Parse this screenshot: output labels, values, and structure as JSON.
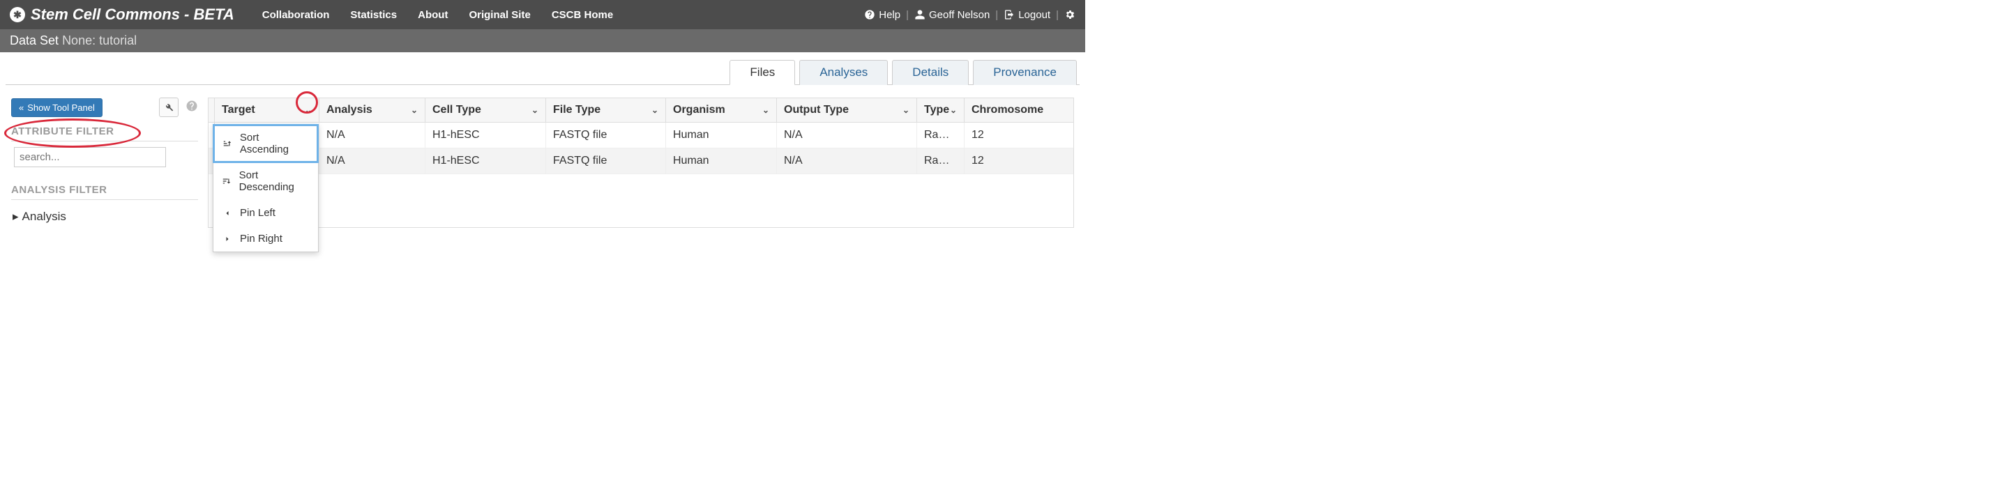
{
  "brand": "Stem Cell Commons - BETA",
  "nav": [
    "Collaboration",
    "Statistics",
    "About",
    "Original Site",
    "CSCB Home"
  ],
  "topRight": {
    "help": "Help",
    "user": "Geoff Nelson",
    "logout": "Logout"
  },
  "sub": {
    "label": "Data Set",
    "value": "None: tutorial"
  },
  "tabs": [
    {
      "label": "Files",
      "active": true
    },
    {
      "label": "Analyses",
      "active": false
    },
    {
      "label": "Details",
      "active": false
    },
    {
      "label": "Provenance",
      "active": false
    }
  ],
  "sidebar": {
    "toolPanelBtn": "Show Tool Panel",
    "attrFilterTitle": "ATTRIBUTE FILTER",
    "searchPlaceholder": "search...",
    "analysisFilterTitle": "ANALYSIS FILTER",
    "analysisItem": "Analysis"
  },
  "columns": [
    "Target",
    "Analysis",
    "Cell Type",
    "File Type",
    "Organism",
    "Output Type",
    "Type",
    "Chromosome"
  ],
  "rows": [
    {
      "analysis": "N/A",
      "celltype": "H1-hESC",
      "filetype": "FASTQ file",
      "organism": "Human",
      "output": "N/A",
      "type": "Raw D…",
      "chrom": "12"
    },
    {
      "analysis": "N/A",
      "celltype": "H1-hESC",
      "filetype": "FASTQ file",
      "organism": "Human",
      "output": "N/A",
      "type": "Raw D…",
      "chrom": "12"
    }
  ],
  "menu": {
    "sortAsc": "Sort Ascending",
    "sortDesc": "Sort Descending",
    "pinLeft": "Pin Left",
    "pinRight": "Pin Right"
  }
}
